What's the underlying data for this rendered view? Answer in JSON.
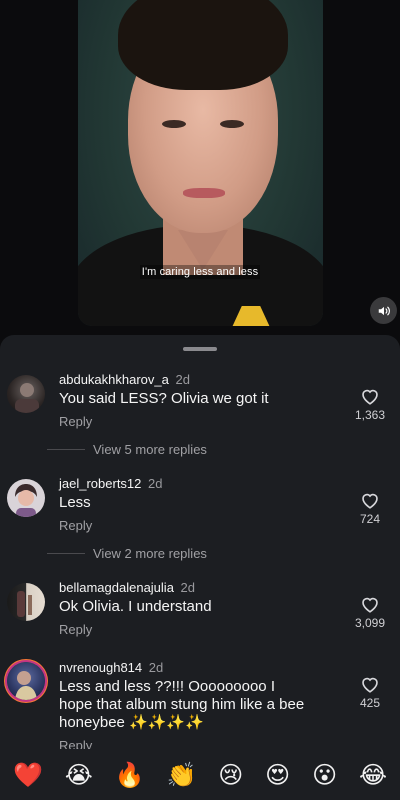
{
  "video": {
    "caption": "I'm caring less and less",
    "sound_icon": "speaker-icon"
  },
  "comments": [
    {
      "username": "abdukakhkharov_a",
      "time": "2d",
      "text": "You said LESS? Olivia we got it",
      "reply_label": "Reply",
      "likes": "1,363",
      "view_more": "View 5 more replies"
    },
    {
      "username": "jael_roberts12",
      "time": "2d",
      "text": "Less",
      "reply_label": "Reply",
      "likes": "724",
      "view_more": "View 2 more replies"
    },
    {
      "username": "bellamagdalenajulia",
      "time": "2d",
      "text": "Ok Olivia. I understand",
      "reply_label": "Reply",
      "likes": "3,099"
    },
    {
      "username": "nvrenough814",
      "time": "2d",
      "text": "Less and less ??!!! Ooooooooo I hope that album stung him like a bee honeybee ✨✨✨✨",
      "reply_label": "Reply",
      "likes": "425"
    }
  ],
  "emoji_bar": [
    "❤️",
    "😭",
    "🔥",
    "👏",
    "😢",
    "😍",
    "😮",
    "😂"
  ],
  "colors": {
    "sheet_bg": "#1c1e22",
    "muted_text": "#a0a0a4",
    "story_ring": "#c13584"
  }
}
